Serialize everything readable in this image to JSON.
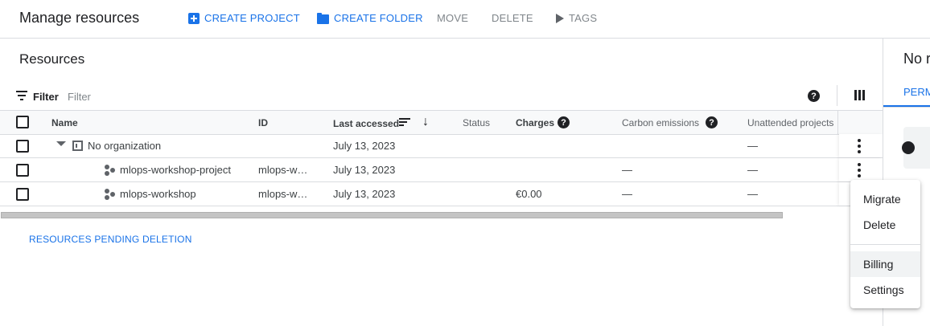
{
  "header": {
    "title": "Manage resources",
    "create_project": "CREATE PROJECT",
    "create_folder": "CREATE FOLDER",
    "move": "MOVE",
    "delete": "DELETE",
    "tags": "TAGS"
  },
  "right_panel": {
    "title": "No r",
    "tab": "PERM"
  },
  "resources": {
    "title": "Resources",
    "filter_label": "Filter",
    "filter_placeholder": "Filter"
  },
  "table": {
    "columns": {
      "name": "Name",
      "id": "ID",
      "last_accessed": "Last accessed",
      "status": "Status",
      "charges": "Charges",
      "carbon": "Carbon emissions",
      "unattended": "Unattended projects"
    },
    "rows": [
      {
        "name": "No organization",
        "id": "",
        "last_accessed": "July 13, 2023",
        "status": "",
        "charges": "",
        "carbon": "",
        "unattended": "—"
      },
      {
        "name": "mlops-workshop-project",
        "id": "mlops-w…",
        "last_accessed": "July 13, 2023",
        "status": "",
        "charges": "",
        "carbon": "—",
        "unattended": "—"
      },
      {
        "name": "mlops-workshop",
        "id": "mlops-w…",
        "last_accessed": "July 13, 2023",
        "status": "",
        "charges": "€0.00",
        "carbon": "—",
        "unattended": "—"
      }
    ]
  },
  "pending_deletion": "RESOURCES PENDING DELETION",
  "context_menu": {
    "items": [
      "Migrate",
      "Delete",
      "Billing",
      "Settings"
    ],
    "highlighted": "Billing"
  },
  "colors": {
    "accent": "#1a73e8",
    "disabled": "#80868b",
    "border": "#dadce0"
  }
}
